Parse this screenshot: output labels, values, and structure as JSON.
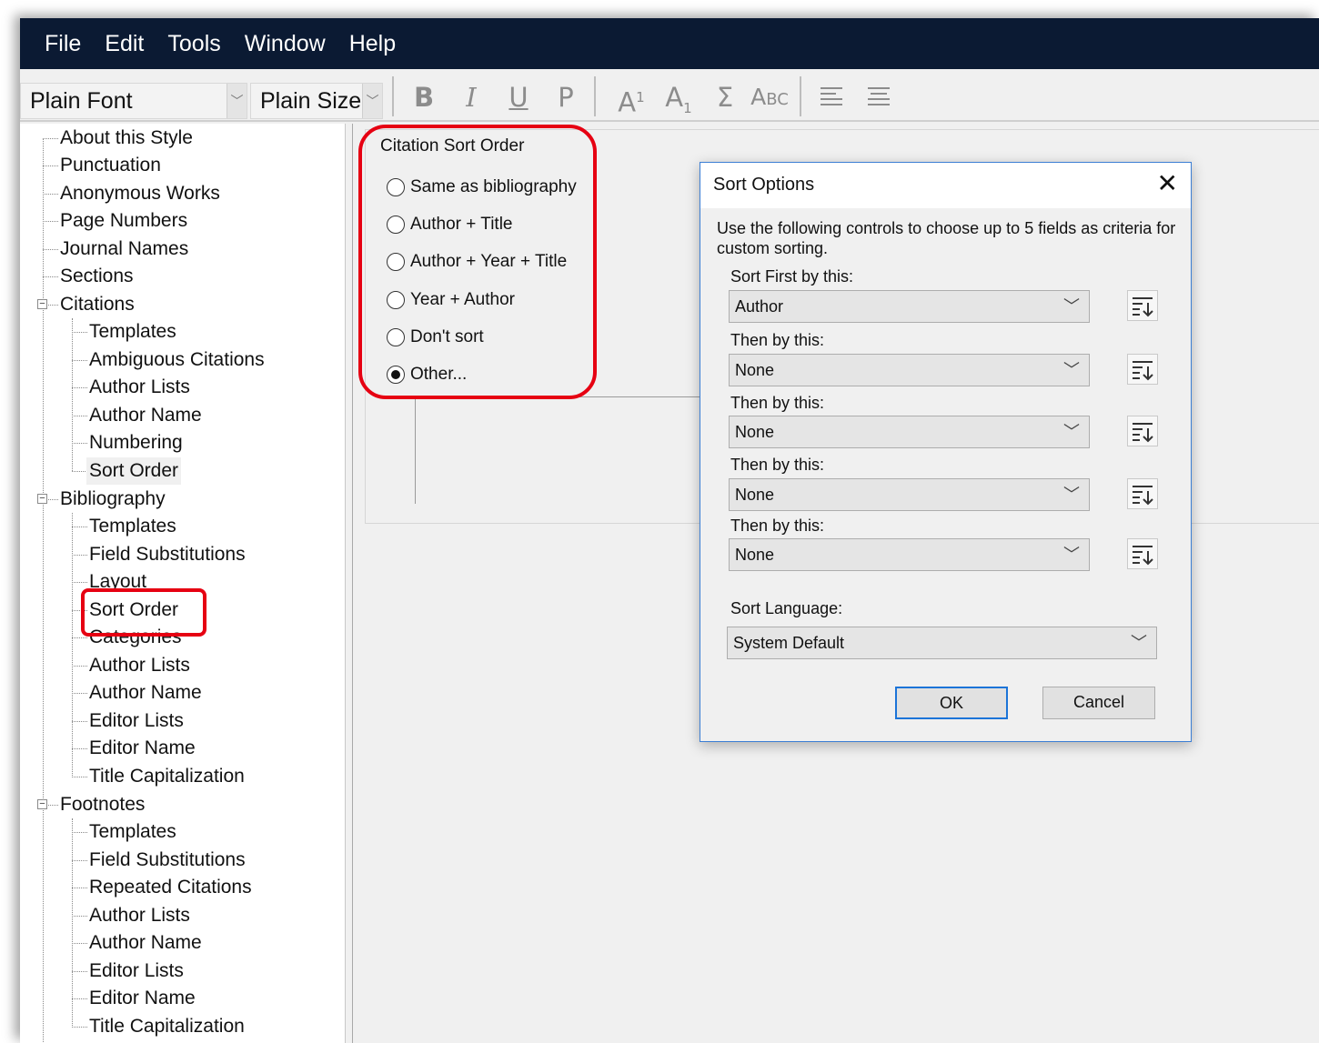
{
  "menu": [
    "File",
    "Edit",
    "Tools",
    "Window",
    "Help"
  ],
  "toolbar": {
    "font": "Plain Font",
    "size": "Plain Size",
    "bold": "B",
    "italic": "I",
    "underline": "U",
    "plain": "P",
    "superscript": "A",
    "superscript_mark": "1",
    "subscript": "A",
    "subscript_mark": "1",
    "symbol": "Σ",
    "smallcaps": "Abc"
  },
  "tree": {
    "about": "About this Style",
    "punctuation": "Punctuation",
    "anonymous": "Anonymous Works",
    "page_numbers": "Page Numbers",
    "journal_names": "Journal Names",
    "sections": "Sections",
    "citations": {
      "label": "Citations",
      "children": [
        "Templates",
        "Ambiguous Citations",
        "Author Lists",
        "Author Name",
        "Numbering",
        "Sort Order"
      ]
    },
    "bibliography": {
      "label": "Bibliography",
      "children": [
        "Templates",
        "Field Substitutions",
        "Layout",
        "Sort Order",
        "Categories",
        "Author Lists",
        "Author Name",
        "Editor Lists",
        "Editor Name",
        "Title Capitalization"
      ]
    },
    "footnotes": {
      "label": "Footnotes",
      "children": [
        "Templates",
        "Field Substitutions",
        "Repeated Citations",
        "Author Lists",
        "Author Name",
        "Editor Lists",
        "Editor Name",
        "Title Capitalization"
      ]
    }
  },
  "citation_sort": {
    "title": "Citation Sort Order",
    "options": [
      "Same as bibliography",
      "Author + Title",
      "Author + Year + Title",
      "Year + Author",
      "Don't sort",
      "Other..."
    ],
    "selected": "Other..."
  },
  "dialog": {
    "title": "Sort Options",
    "close": "✕",
    "description": "Use the following controls to choose up to 5 fields as criteria for custom sorting.",
    "fields": [
      {
        "label": "Sort First by this:",
        "value": "Author"
      },
      {
        "label": "Then by this:",
        "value": "None"
      },
      {
        "label": "Then by this:",
        "value": "None"
      },
      {
        "label": "Then by this:",
        "value": "None"
      },
      {
        "label": "Then by this:",
        "value": "None"
      }
    ],
    "language_label": "Sort Language:",
    "language_value": "System Default",
    "ok": "OK",
    "cancel": "Cancel"
  },
  "colors": {
    "menubar": "#0b1a33",
    "highlight": "#e60012",
    "dialog_border": "#3b7ed4"
  }
}
